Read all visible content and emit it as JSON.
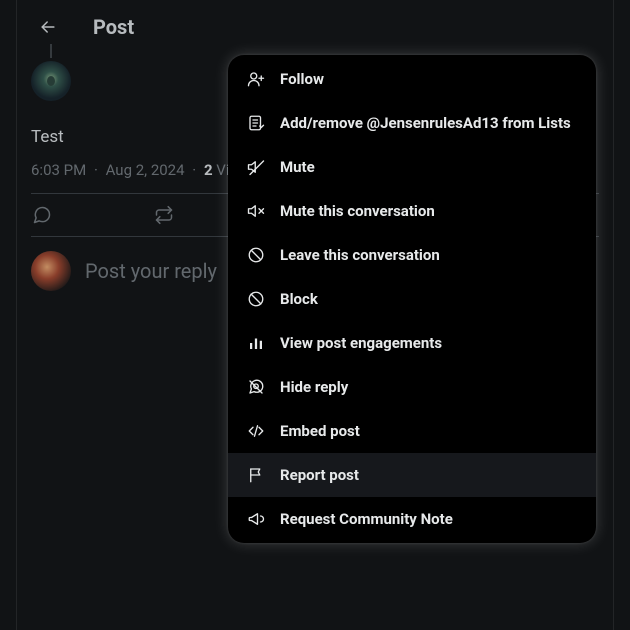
{
  "header": {
    "title": "Post"
  },
  "post": {
    "content": "Test",
    "time": "6:03 PM",
    "date": "Aug 2, 2024",
    "views_count": "2",
    "views_label_truncated": "Vi"
  },
  "reply": {
    "placeholder": "Post your reply"
  },
  "menu": {
    "items": [
      {
        "icon": "user-plus-icon",
        "label": "Follow"
      },
      {
        "icon": "list-edit-icon",
        "label": "Add/remove @JensenrulesAd13 from Lists"
      },
      {
        "icon": "mute-icon",
        "label": "Mute"
      },
      {
        "icon": "mute-convo-icon",
        "label": "Mute this conversation"
      },
      {
        "icon": "leave-convo-icon",
        "label": "Leave this conversation"
      },
      {
        "icon": "block-icon",
        "label": "Block"
      },
      {
        "icon": "analytics-icon",
        "label": "View post engagements"
      },
      {
        "icon": "hide-reply-icon",
        "label": "Hide reply"
      },
      {
        "icon": "code-icon",
        "label": "Embed post"
      },
      {
        "icon": "flag-icon",
        "label": "Report post",
        "highlighted": true
      },
      {
        "icon": "megaphone-icon",
        "label": "Request Community Note"
      }
    ]
  }
}
